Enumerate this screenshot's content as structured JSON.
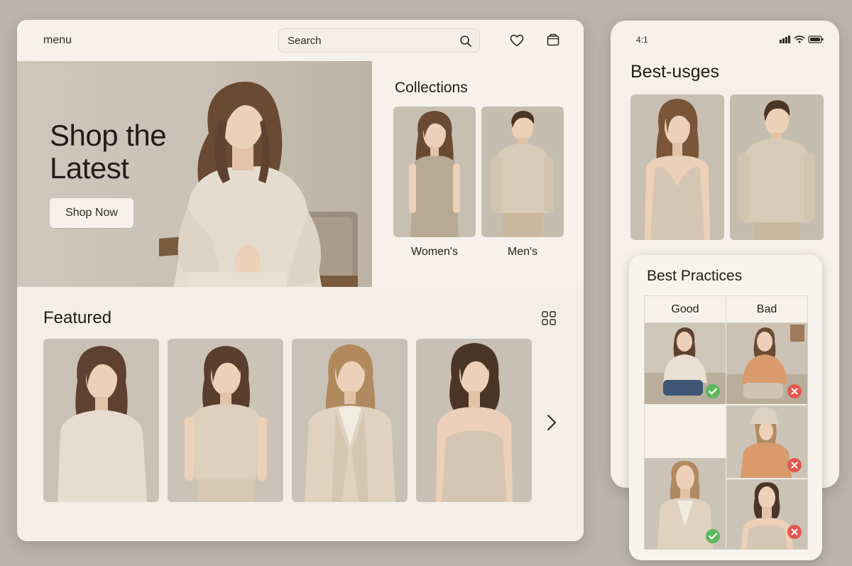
{
  "desktop": {
    "menu_label": "menu",
    "search": {
      "placeholder": "Search"
    },
    "hero": {
      "title_line1": "Shop the",
      "title_line2": "Latest",
      "cta_label": "Shop Now"
    },
    "collections": {
      "title": "Collections",
      "items": [
        {
          "label": "Women's"
        },
        {
          "label": "Men's"
        }
      ]
    },
    "featured": {
      "title": "Featured"
    }
  },
  "phone": {
    "status_time": "4:1",
    "title": "Best-usges",
    "best_practices": {
      "title": "Best Practices",
      "columns": [
        "Good",
        "Bad"
      ]
    }
  },
  "colors": {
    "background": "#b9b4ad",
    "panel": "#f3eee6",
    "good_badge": "#5cb85c",
    "bad_badge": "#e0584f",
    "beige_clothing": "#e4dccf",
    "orange_clothing": "#d99a6c"
  },
  "icons": [
    "search-icon",
    "heart-icon",
    "bag-icon",
    "grid-icon",
    "chevron-right-icon",
    "check-icon",
    "x-icon",
    "signal-icon",
    "wifi-icon",
    "battery-icon"
  ]
}
